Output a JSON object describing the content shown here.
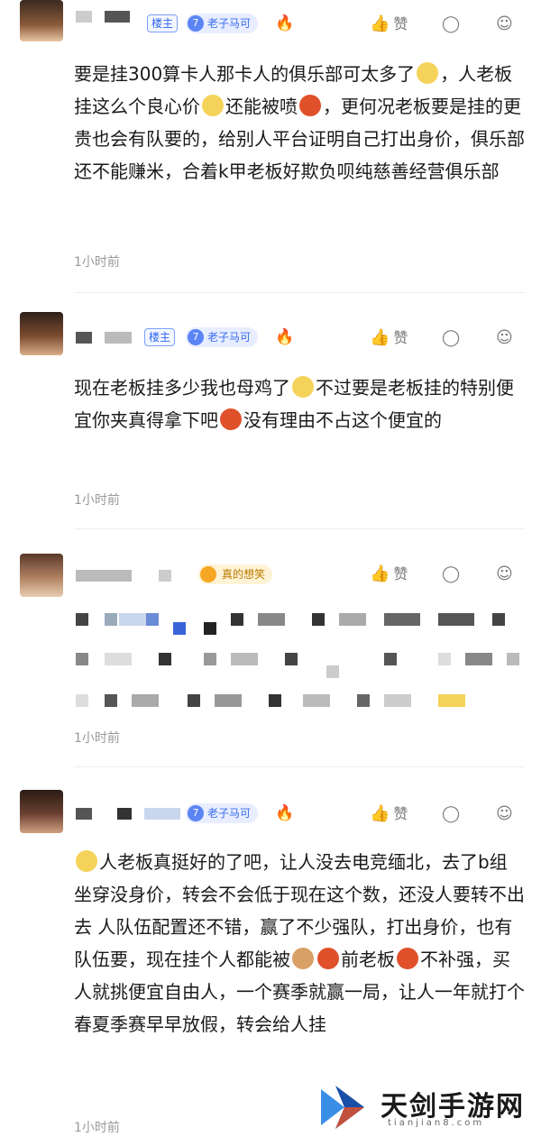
{
  "comments": [
    {
      "host_badge": "楼主",
      "level": "7",
      "level_title": "老子马可",
      "like_label": "赞",
      "text": "要是挂300算卡人那卡人的俱乐部可太多了",
      "text2": "，人老板挂这么个良心价",
      "text3": "还能被喷",
      "text4": "，更何况老板要是挂的更贵也会有队要的，给别人平台证明自己打出身价，俱乐部还不能赚米，合着k甲老板好欺负呗纯慈善经营俱乐部",
      "time": "1小时前"
    },
    {
      "host_badge": "楼主",
      "level": "7",
      "level_title": "老子马可",
      "like_label": "赞",
      "text": "现在老板挂多少我也母鸡了",
      "text2": "不过要是老板挂的特别便宜你夹真得拿下吧",
      "text3": "没有理由不占这个便宜的",
      "time": "1小时前"
    },
    {
      "badge": "真的想笑",
      "like_label": "赞",
      "time": "1小时前"
    },
    {
      "level": "7",
      "level_title": "老子马可",
      "like_label": "赞",
      "text": "人老板真挺好的了吧，让人没去电竞缅北，去了b组坐穿没身价，转会不会低于现在这个数，还没人要转不出去 人队伍配置还不错，赢了不少强队，打出身价，也有队伍要，现在挂个人都能被",
      "text2": "前老板",
      "text3": "不补强，买人就挑便宜自由人，一个赛季就赢一局，让人一年就打个春夏季赛早早放假，转会给人挂",
      "time": "1小时前"
    }
  ],
  "watermark": {
    "name": "天剑手游网",
    "url": "tianjian8.com"
  },
  "colors": {
    "accent_blue": "#2f64f0",
    "time_grey": "#999999",
    "badge_orange": "#f5a623"
  },
  "icons": [
    "thumbs-up-icon",
    "dislike-icon",
    "reply-icon",
    "fire-icon"
  ]
}
